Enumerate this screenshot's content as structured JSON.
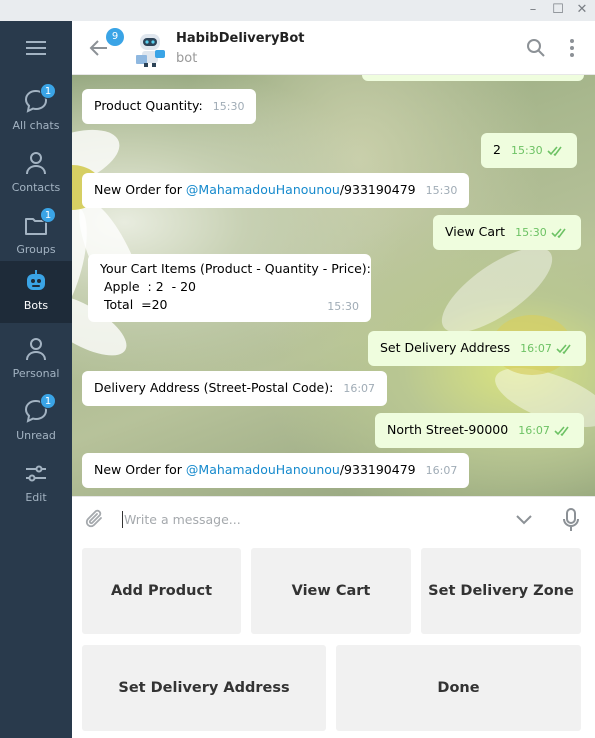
{
  "window": {
    "controls": [
      {
        "name": "minimize",
        "glyph": "–"
      },
      {
        "name": "maximize",
        "glyph": "☐"
      },
      {
        "name": "close",
        "glyph": "✕"
      }
    ]
  },
  "sidebar": {
    "items": [
      {
        "label": "All chats",
        "icon": "chat-bubble-icon",
        "badge": "1",
        "active": false
      },
      {
        "label": "Contacts",
        "icon": "person-icon",
        "badge": "",
        "active": false
      },
      {
        "label": "Groups",
        "icon": "folder-icon",
        "badge": "1",
        "active": false
      },
      {
        "label": "Bots",
        "icon": "robot-icon",
        "badge": "",
        "active": true
      },
      {
        "label": "Personal",
        "icon": "person-icon",
        "badge": "",
        "active": false
      },
      {
        "label": "Unread",
        "icon": "chat-bubble-icon",
        "badge": "1",
        "active": false
      },
      {
        "label": "Edit",
        "icon": "sliders-icon",
        "badge": "",
        "active": false
      }
    ]
  },
  "header": {
    "back_badge": "9",
    "title": "HabibDeliveryBot",
    "subtitle": "bot"
  },
  "messages": [
    {
      "dir": "in",
      "text": "Product Quantity:",
      "time": "15:30"
    },
    {
      "dir": "out",
      "text": "2",
      "time": "15:30"
    },
    {
      "dir": "in",
      "prefix": "New Order for ",
      "link": "@MahamadouHanounou",
      "suffix": "/933190479",
      "time": "15:30"
    },
    {
      "dir": "out",
      "text": "View Cart",
      "time": "15:30"
    },
    {
      "dir": "in",
      "lines": [
        "Your Cart Items (Product - Quantity - Price):",
        " Apple  : 2  - 20",
        " Total  =20"
      ],
      "time": "15:30"
    },
    {
      "dir": "out",
      "text": "Set Delivery Address",
      "time": "16:07"
    },
    {
      "dir": "in",
      "text": "Delivery Address (Street-Postal Code):",
      "time": "16:07"
    },
    {
      "dir": "out",
      "text": "North Street-90000",
      "time": "16:07"
    },
    {
      "dir": "in",
      "prefix": "New Order for ",
      "link": "@MahamadouHanounou",
      "suffix": "/933190479",
      "time": "16:07"
    }
  ],
  "composer": {
    "placeholder": "Write a message..."
  },
  "keyboard": {
    "buttons": [
      "Add Product",
      "View Cart",
      "Set Delivery Zone",
      "Set Delivery Address",
      "Done"
    ]
  },
  "colors": {
    "sidebar_bg": "#293a4c",
    "sidebar_active": "#1e2b39",
    "badge": "#3aa4e6",
    "outgoing_bubble": "#effdde",
    "check_green": "#6dc264",
    "link": "#168acd"
  }
}
